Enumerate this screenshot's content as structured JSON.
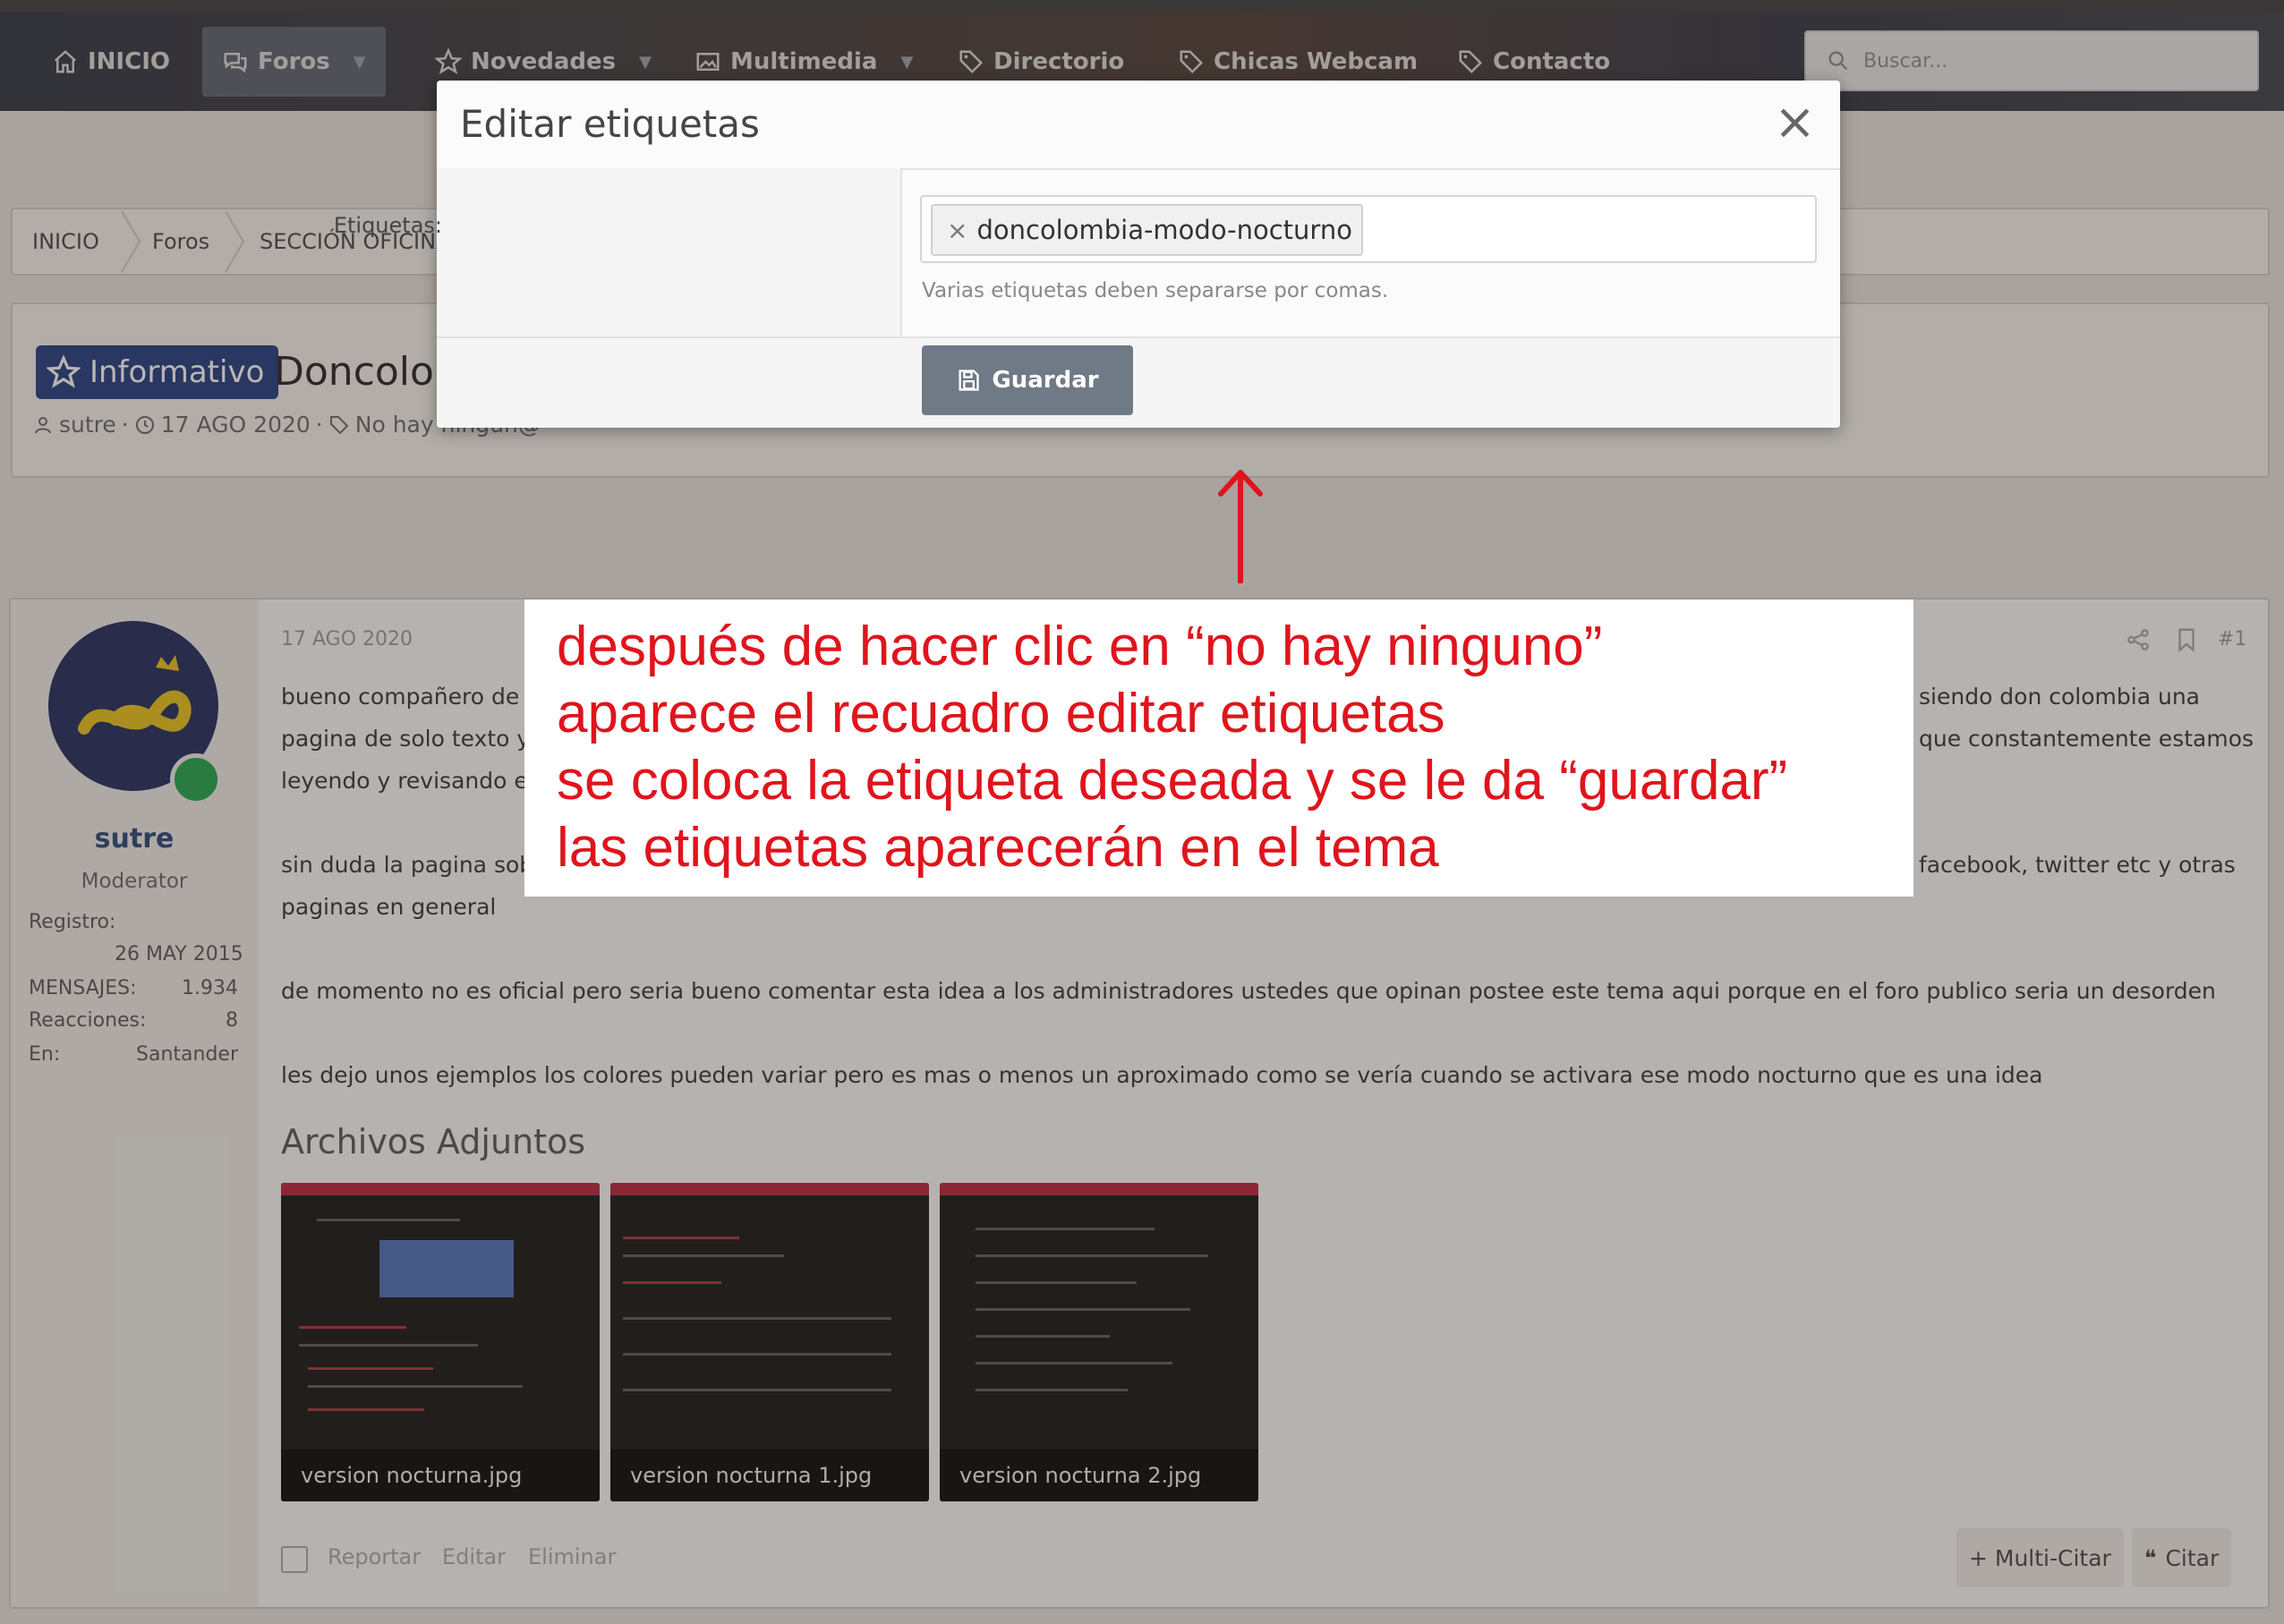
{
  "nav": {
    "items": [
      {
        "label": "INICIO",
        "icon": "home-icon"
      },
      {
        "label": "Foros",
        "icon": "chat-icon"
      },
      {
        "label": "Novedades",
        "icon": "star-icon"
      },
      {
        "label": "Multimedia",
        "icon": "image-icon"
      },
      {
        "label": "Directorio",
        "icon": "tag-icon"
      },
      {
        "label": "Chicas Webcam",
        "icon": "tag-icon"
      },
      {
        "label": "Contacto",
        "icon": "tag-icon"
      }
    ],
    "search_placeholder": "Buscar..."
  },
  "breadcrumb": [
    "INICIO",
    "Foros",
    "SECCIÓN OFICINA"
  ],
  "thread": {
    "prefix": "Informativo",
    "title": "Doncolon",
    "author": "sutre",
    "date": "17 AGO 2020",
    "tags_text": "No hay ningun@"
  },
  "user": {
    "name": "sutre",
    "role": "Moderator",
    "registro_label": "Registro:",
    "registro_value": "26 MAY 2015",
    "mensajes_label": "MENSAJES:",
    "mensajes_value": "1.934",
    "reacciones_label": "Reacciones:",
    "reacciones_value": "8",
    "en_label": "En:",
    "en_value": "Santander"
  },
  "post": {
    "date": "17 AGO 2020",
    "number": "#1",
    "lines": [
      "bueno compañero de",
      "pagina de solo texto y",
      "leyendo y revisando el",
      "sin duda la pagina sob",
      "paginas en general",
      "de momento no es oficial pero seria bueno comentar esta idea a los administradores ustedes que opinan postee este tema aqui porque en el foro publico seria un desorden",
      "les dejo unos ejemplos los colores pueden variar pero es mas o menos un aproximado como se vería cuando se activara ese modo nocturno que es una idea"
    ],
    "right_fragments": [
      "siendo don colombia una",
      "que constantemente estamos",
      "facebook, twitter etc y otras"
    ],
    "attachments_title": "Archivos Adjuntos",
    "attachments": [
      "version nocturna.jpg",
      "version nocturna 1.jpg",
      "version nocturna 2.jpg"
    ],
    "footer": {
      "report": "Reportar",
      "edit": "Editar",
      "delete": "Eliminar",
      "multiquote": "+ Multi-Citar",
      "quote": "Citar"
    }
  },
  "modal": {
    "title": "Editar etiquetas",
    "label": "Etiquetas:",
    "tag": "doncolombia-modo-nocturno",
    "hint": "Varias etiquetas deben separarse por comas.",
    "save": "Guardar"
  },
  "annotation": {
    "lines": [
      "después de hacer clic en “no hay ninguno”",
      "aparece el recuadro editar etiquetas",
      "se coloca la etiqueta deseada y se le da “guardar”",
      "las etiquetas aparecerán en el tema"
    ],
    "color": "#e0141c"
  },
  "colors": {
    "prefix_badge": "#1f3b80",
    "save_button": "#6f7a86",
    "online": "#1ea54a"
  }
}
